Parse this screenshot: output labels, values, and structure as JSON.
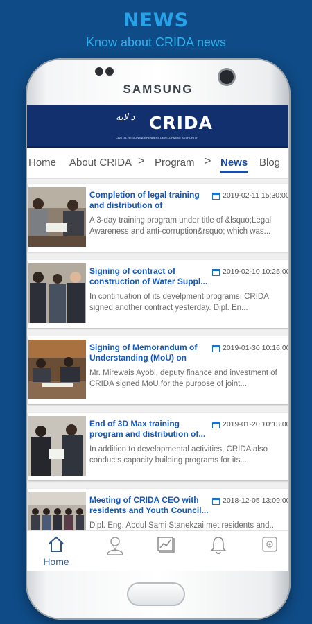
{
  "promo": {
    "title": "NEWS",
    "subtitle": "Know about CRIDA news"
  },
  "device": {
    "brand": "SAMSUNG"
  },
  "header": {
    "logo_text": "CRIDA",
    "logo_arabic": "د لایه",
    "logo_subtitle": "CAPITAL REGION INDEPENDENT DEVELOPMENT AUTHORITY"
  },
  "navbar": {
    "items": [
      {
        "label": "Home",
        "active": false
      },
      {
        "label": "About CRIDA",
        "active": false
      },
      {
        "label": "Program",
        "active": false
      },
      {
        "label": "News",
        "active": true
      },
      {
        "label": "Blog",
        "active": false
      }
    ],
    "chevron": ">"
  },
  "news": [
    {
      "title": "Completion of legal training and distribution of certificates",
      "date": "2019-02-11 15:30:00",
      "description": "A 3-day training program under title of &lsquo;Legal Awareness and anti-corruption&rsquo; which was..."
    },
    {
      "title": "Signing of contract of construction of Water Suppl...",
      "date": "2019-02-10 10:25:00",
      "description": "In continuation of its develpment programs, CRIDA signed another contract yesterday. Dipl. En..."
    },
    {
      "title": "Signing of Memorandum of Understanding (MoU) on join...",
      "date": "2019-01-30 10:16:00",
      "description": "Mr. Mirewais Ayobi, deputy finance and investment of CRIDA signed MoU for the purpose of joint..."
    },
    {
      "title": "End of 3D Max training program and distribution of...",
      "date": "2019-01-20 10:13:00",
      "description": "In addition to developmental activities, CRIDA also conducts capacity building programs for its..."
    },
    {
      "title": "Meeting of CRIDA CEO with residents and Youth Council...",
      "date": "2018-12-05 13:09:00",
      "description": "Dipl. Eng. Abdul Sami Stanekzai met residents and..."
    }
  ],
  "bottom_nav": {
    "home_label": "Home",
    "icons": [
      "home-icon",
      "user-icon",
      "chart-icon",
      "bell-icon",
      "settings-icon"
    ]
  },
  "colors": {
    "background": "#0f4b86",
    "accent": "#1b4ea3",
    "header": "#13306e",
    "title_text": "#1557b5"
  }
}
